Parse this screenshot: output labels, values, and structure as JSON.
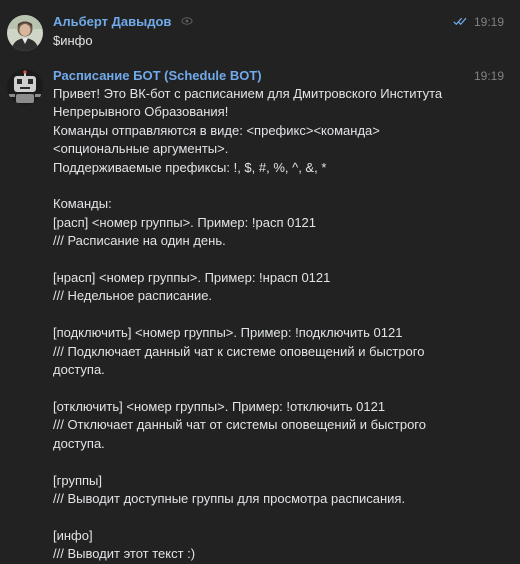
{
  "messages": [
    {
      "author": "Альберт Давыдов",
      "time": "19:19",
      "read": true,
      "lines": [
        "$инфо"
      ]
    },
    {
      "author": "Расписание БОТ (Schedule BOT)",
      "time": "19:19",
      "lines": [
        "Привет! Это ВК-бот с расписанием для Дмитровского Института",
        "Непрерывного Образования!",
        "Команды отправляются в виде: <префикс><команда>",
        "<опциональные аргументы>.",
        "Поддерживаемые префиксы: !, $, #, %, ^, &, *",
        "",
        "Команды:",
        "[расп] <номер группы>. Пример: !расп 0121",
        "/// Расписание на один день.",
        "",
        "[нрасп] <номер группы>. Пример: !нрасп 0121",
        "/// Недельное расписание.",
        "",
        "[подключить] <номер группы>. Пример: !подключить 0121",
        "/// Подключает данный чат к системе оповещений и быстрого",
        "доступа.",
        "",
        "[отключить] <номер группы>. Пример: !отключить 0121",
        "/// Отключает данный чат от системы оповещений и быстрого",
        "доступа.",
        "",
        "[группы]",
        "/// Выводит доступные группы для просмотра расписания.",
        "",
        "[инфо]",
        "/// Выводит этот текст :)"
      ]
    }
  ],
  "icons": {
    "edit": "eye-edit-icon",
    "read": "double-check-icon"
  },
  "colors": {
    "background": "#222222",
    "author": "#71aaeb",
    "text": "#e1e3e6",
    "time": "#828282"
  }
}
